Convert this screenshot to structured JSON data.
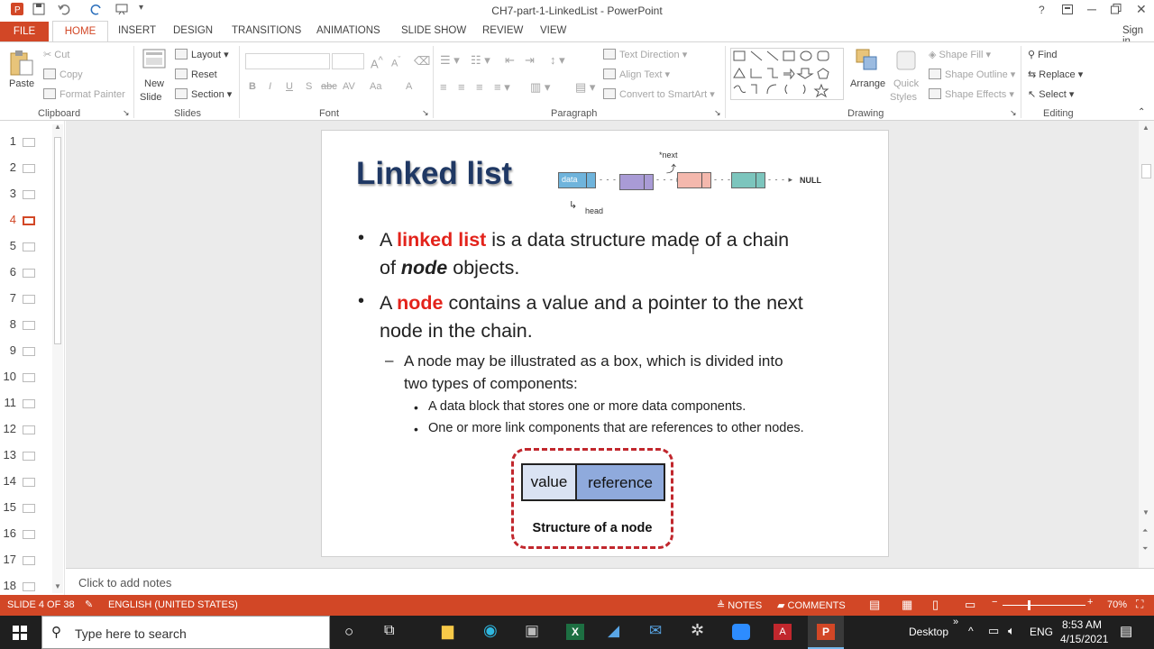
{
  "window": {
    "title": "CH7-part-1-LinkedList - PowerPoint",
    "help": "?",
    "signin": "Sign in"
  },
  "tabs": [
    "FILE",
    "HOME",
    "INSERT",
    "DESIGN",
    "TRANSITIONS",
    "ANIMATIONS",
    "SLIDE SHOW",
    "REVIEW",
    "VIEW"
  ],
  "ribbon": {
    "clipboard": {
      "label": "Clipboard",
      "paste": "Paste",
      "cut": "Cut",
      "copy": "Copy",
      "format_painter": "Format Painter"
    },
    "slides": {
      "label": "Slides",
      "new_slide_1": "New",
      "new_slide_2": "Slide",
      "layout": "Layout",
      "reset": "Reset",
      "section": "Section"
    },
    "font": {
      "label": "Font",
      "bold": "B",
      "italic": "I",
      "underline": "U",
      "shadow": "S",
      "strike": "abc",
      "spacing": "AV",
      "case": "Aa",
      "color": "A"
    },
    "paragraph": {
      "label": "Paragraph",
      "text_direction": "Text Direction",
      "align_text": "Align Text",
      "smartart": "Convert to SmartArt"
    },
    "drawing": {
      "label": "Drawing",
      "arrange": "Arrange",
      "quick_styles_1": "Quick",
      "quick_styles_2": "Styles",
      "shape_fill": "Shape Fill",
      "shape_outline": "Shape Outline",
      "shape_effects": "Shape Effects"
    },
    "editing": {
      "label": "Editing",
      "find": "Find",
      "replace": "Replace",
      "select": "Select"
    }
  },
  "thumbnails": [
    {
      "num": "1"
    },
    {
      "num": "2"
    },
    {
      "num": "3"
    },
    {
      "num": "4",
      "selected": true
    },
    {
      "num": "5"
    },
    {
      "num": "6"
    },
    {
      "num": "7"
    },
    {
      "num": "8"
    },
    {
      "num": "9"
    },
    {
      "num": "10"
    },
    {
      "num": "11"
    },
    {
      "num": "12"
    },
    {
      "num": "13"
    },
    {
      "num": "14"
    },
    {
      "num": "15"
    },
    {
      "num": "16"
    },
    {
      "num": "17"
    },
    {
      "num": "18"
    }
  ],
  "slide": {
    "title": "Linked list",
    "diagram": {
      "next_label": "*next",
      "head_label": "head",
      "data_label": "data",
      "null_label": "NULL"
    },
    "bullet1": {
      "a": "A ",
      "term": "linked list",
      "rest": " is a data structure made of a chain",
      "line2a": "of ",
      "line2b": "node",
      "line2c": " objects."
    },
    "bullet2": {
      "a": "A ",
      "term": "node",
      "rest": " contains a value and a pointer to the next",
      "line2": "node in the chain."
    },
    "sub1": {
      "dash": "–",
      "line1": "A node may be illustrated as a box, which is divided into",
      "line2": "two types of components:"
    },
    "sub2": [
      "A data block that stores one or more data components.",
      "One or more link components that are references to other nodes."
    ],
    "node_box": {
      "value": "value",
      "reference": "reference",
      "caption": "Structure of a node"
    }
  },
  "notes": {
    "placeholder": "Click to add notes"
  },
  "status": {
    "slide": "SLIDE 4 OF 38",
    "language": "ENGLISH (UNITED STATES)",
    "notes": "NOTES",
    "comments": "COMMENTS",
    "zoom": "70%"
  },
  "taskbar": {
    "search_placeholder": "Type here to search",
    "desktop": "Desktop",
    "lang": "ENG",
    "time": "8:53 AM",
    "date": "4/15/2021"
  },
  "colors": {
    "accent": "#d24726",
    "title": "#1f3864",
    "red": "#e3231b"
  }
}
